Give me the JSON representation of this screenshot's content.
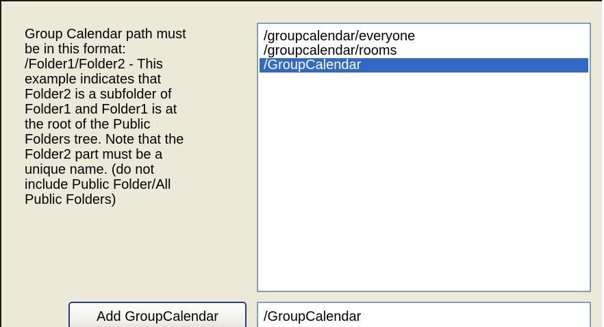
{
  "help_text": "Group Calendar path must\nbe in this format:\n/Folder1/Folder2 - This\nexample indicates that\nFolder2 is a subfolder of\nFolder1 and Folder1 is at\nthe root of the Public\nFolders tree.  Note that the\nFolder2 part must be a\nunique name. (do not\ninclude Public Folder/All\nPublic Folders)",
  "calendar_list": {
    "items": [
      {
        "label": "/groupcalendar/everyone",
        "selected": false
      },
      {
        "label": "/groupcalendar/rooms",
        "selected": false
      },
      {
        "label": "/GroupCalendar",
        "selected": true
      }
    ]
  },
  "add_button_label": "Add GroupCalendar",
  "path_input_value": "/GroupCalendar"
}
